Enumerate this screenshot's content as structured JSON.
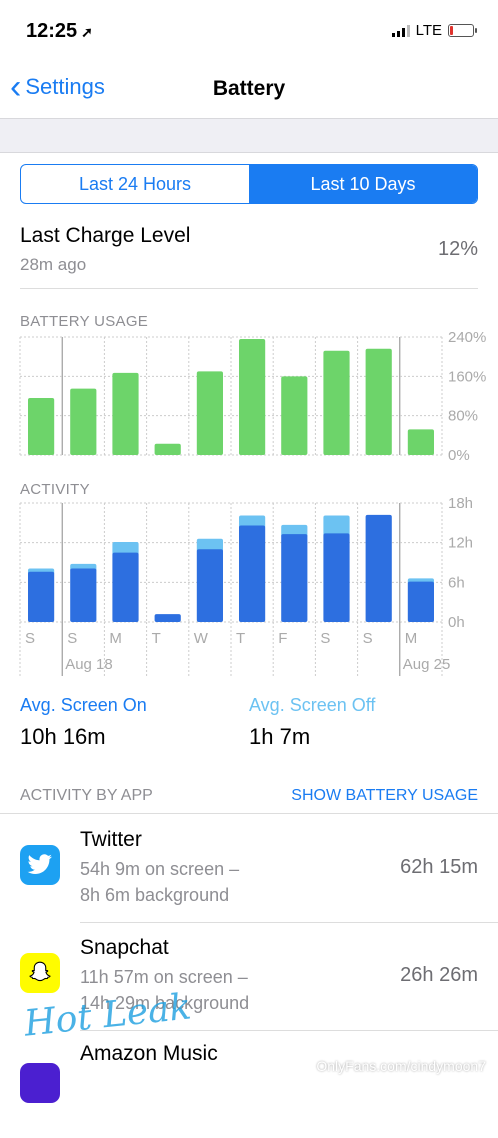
{
  "status_bar": {
    "time": "12:25",
    "network": "LTE"
  },
  "navbar": {
    "back_label": "Settings",
    "title": "Battery"
  },
  "segment": {
    "left": "Last 24 Hours",
    "right": "Last 10 Days",
    "active": "right"
  },
  "last_charge": {
    "title": "Last Charge Level",
    "subtitle": "28m ago",
    "value": "12%"
  },
  "battery_usage": {
    "label": "BATTERY USAGE",
    "y_ticks": [
      "240%",
      "160%",
      "80%",
      "0%"
    ],
    "color": "#6dd46a"
  },
  "activity": {
    "label": "ACTIVITY",
    "y_ticks": [
      "18h",
      "12h",
      "6h",
      "0h"
    ],
    "x_labels": [
      "S",
      "S",
      "M",
      "T",
      "W",
      "T",
      "F",
      "S",
      "S",
      "M"
    ],
    "date_labels": [
      "Aug 18",
      "Aug 25"
    ],
    "screen_on_color": "#2d6fe0",
    "screen_off_color": "#6cc2f2"
  },
  "chart_data": [
    {
      "type": "bar",
      "title": "BATTERY USAGE",
      "categories": [
        "S",
        "S",
        "M",
        "T",
        "W",
        "T",
        "F",
        "S",
        "S",
        "M"
      ],
      "values": [
        116,
        135,
        167,
        23,
        170,
        236,
        160,
        212,
        216,
        52
      ],
      "ylim": [
        0,
        240
      ],
      "unit": "%"
    },
    {
      "type": "bar",
      "title": "ACTIVITY",
      "categories": [
        "S",
        "S",
        "M",
        "T",
        "W",
        "T",
        "F",
        "S",
        "S",
        "M"
      ],
      "stacked": true,
      "series": [
        {
          "name": "Avg. Screen On",
          "values": [
            7.6,
            8.1,
            10.5,
            1.2,
            11.0,
            14.6,
            13.3,
            13.4,
            16.2,
            6.1
          ]
        },
        {
          "name": "Avg. Screen Off",
          "values": [
            0.5,
            0.7,
            1.6,
            0,
            1.6,
            1.5,
            1.4,
            2.7,
            0,
            0.5
          ]
        }
      ],
      "ylim": [
        0,
        18
      ],
      "unit": "h"
    }
  ],
  "averages": {
    "screen_on_label": "Avg. Screen On",
    "screen_on_value": "10h 16m",
    "screen_off_label": "Avg. Screen Off",
    "screen_off_value": "1h 7m"
  },
  "activity_by_app": {
    "header": "ACTIVITY BY APP",
    "link": "SHOW BATTERY USAGE",
    "apps": [
      {
        "name": "Twitter",
        "line1": "54h 9m on screen –",
        "line2": "8h 6m background",
        "total": "62h 15m",
        "icon": "twitter-bird-icon",
        "color": "#1da1f2"
      },
      {
        "name": "Snapchat",
        "line1": "11h 57m on screen –",
        "line2": "14h 29m background",
        "total": "26h 26m",
        "icon": "snapchat-ghost-icon",
        "color": "#fffc00"
      },
      {
        "name": "Amazon Music",
        "line1": "",
        "line2": "",
        "total": "",
        "icon": "amazon-music-icon",
        "color": "#4b1fd0"
      }
    ]
  },
  "watermark": {
    "text": "OnlyFans.com/cindymoon7",
    "logo": "Hot Leak"
  }
}
